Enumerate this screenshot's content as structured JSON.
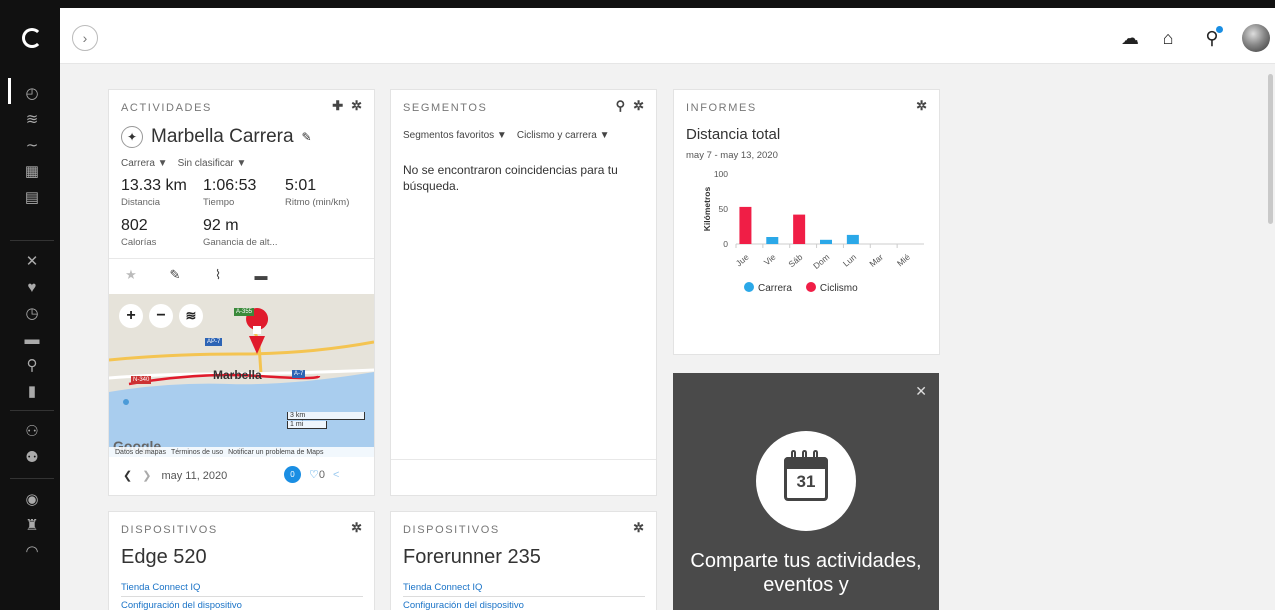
{
  "topbar": {
    "expand_icon": "chevron-right-icon",
    "icons": [
      "cloud-upload-icon",
      "inbox-icon",
      "watch-icon",
      "avatar"
    ]
  },
  "sidebar": {
    "icons": [
      "dashboard-icon",
      "layers-icon",
      "activity-icon",
      "calendar-icon",
      "news-icon",
      "training-icon",
      "health-icon",
      "timer-icon",
      "gear-shoe-icon",
      "location-icon",
      "reports-icon",
      "connections-icon",
      "groups-icon",
      "insights-icon",
      "trophy-icon",
      "more-icon"
    ]
  },
  "activities": {
    "label": "ACTIVIDADES",
    "title": "Marbella Carrera",
    "type_filter": "Carrera ▼",
    "class_filter": "Sin clasificar ▼",
    "stats": [
      {
        "value": "13.33 km",
        "label": "Distancia"
      },
      {
        "value": "1:06:53",
        "label": "Tiempo"
      },
      {
        "value": "5:01",
        "label": "Ritmo (min/km)"
      },
      {
        "value": "802",
        "label": "Calorías"
      },
      {
        "value": "92 m",
        "label": "Ganancia de alt..."
      }
    ],
    "map": {
      "city": "Marbella",
      "roads": [
        "A-355",
        "AP-7",
        "N-340",
        "A-7"
      ],
      "scale_km": "3 km",
      "scale_mi": "1 mi",
      "google": "Google",
      "footer": [
        "Datos de mapas",
        "Términos de uso",
        "Notificar un problema de Maps"
      ]
    },
    "date": "may 11, 2020",
    "comments": "0",
    "likes": "0"
  },
  "segments": {
    "label": "SEGMENTOS",
    "filter_fav": "Segmentos favoritos ▼",
    "filter_type": "Ciclismo y carrera ▼",
    "empty": "No se encontraron coincidencias para tu búsqueda."
  },
  "reports": {
    "label": "INFORMES",
    "title": "Distancia total",
    "date_range": "may 7 - may 13, 2020",
    "legend": [
      "Carrera",
      "Ciclismo"
    ]
  },
  "chart_data": {
    "type": "bar",
    "categories": [
      "Jue",
      "Vie",
      "Sáb",
      "Dom",
      "Lun",
      "Mar",
      "Mié"
    ],
    "series": [
      {
        "name": "Ciclismo",
        "values": [
          53,
          0,
          42,
          0,
          0,
          0,
          0
        ]
      },
      {
        "name": "Carrera",
        "values": [
          0,
          10,
          0,
          6,
          13,
          0,
          0
        ]
      }
    ],
    "ylabel": "Kilómetros",
    "yticks": [
      0,
      50,
      100
    ],
    "ylim": [
      0,
      100
    ],
    "colors": {
      "Carrera": "#2ba8e8",
      "Ciclismo": "#f01e46"
    }
  },
  "promo": {
    "calendar_day": "31",
    "text": "Comparte tus actividades, eventos y"
  },
  "devices": [
    {
      "label": "DISPOSITIVOS",
      "name": "Edge 520",
      "link1": "Tienda Connect IQ",
      "link2": "Configuración del dispositivo"
    },
    {
      "label": "DISPOSITIVOS",
      "name": "Forerunner 235",
      "link1": "Tienda Connect IQ",
      "link2": "Configuración del dispositivo"
    }
  ]
}
